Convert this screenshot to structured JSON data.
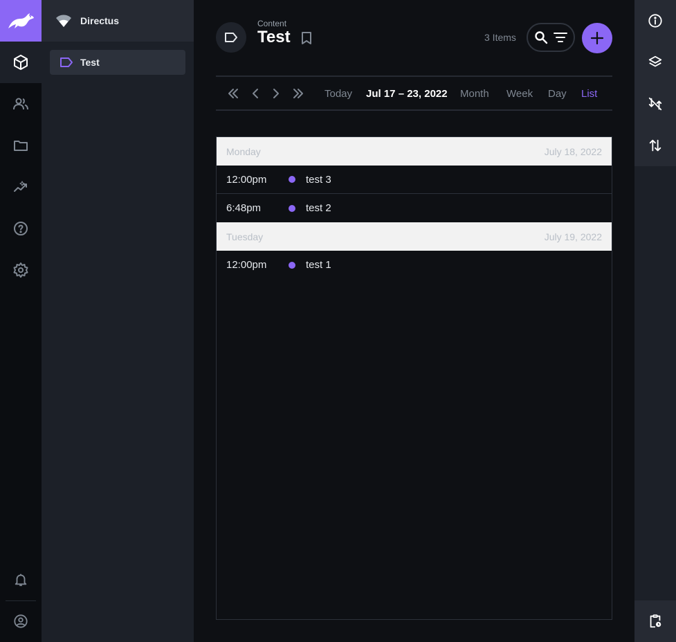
{
  "project": {
    "name": "Directus"
  },
  "navigation": {
    "items": [
      {
        "label": "Test"
      }
    ]
  },
  "header": {
    "breadcrumb": "Content",
    "title": "Test",
    "item_count": "3 Items"
  },
  "calendar": {
    "controls": {
      "today": "Today"
    },
    "range": "Jul 17 – 23, 2022",
    "views": [
      "Month",
      "Week",
      "Day",
      "List"
    ],
    "active_view": "List"
  },
  "days": [
    {
      "weekday": "Monday",
      "date": "July 18, 2022",
      "events": [
        {
          "time": "12:00pm",
          "title": "test 3"
        },
        {
          "time": "6:48pm",
          "title": "test 2"
        }
      ]
    },
    {
      "weekday": "Tuesday",
      "date": "July 19, 2022",
      "events": [
        {
          "time": "12:00pm",
          "title": "test 1"
        }
      ]
    }
  ],
  "colors": {
    "accent": "#8b67f5",
    "background": "#0e1014",
    "nav": "#1c2028",
    "day_header": "#f2f2f2"
  }
}
